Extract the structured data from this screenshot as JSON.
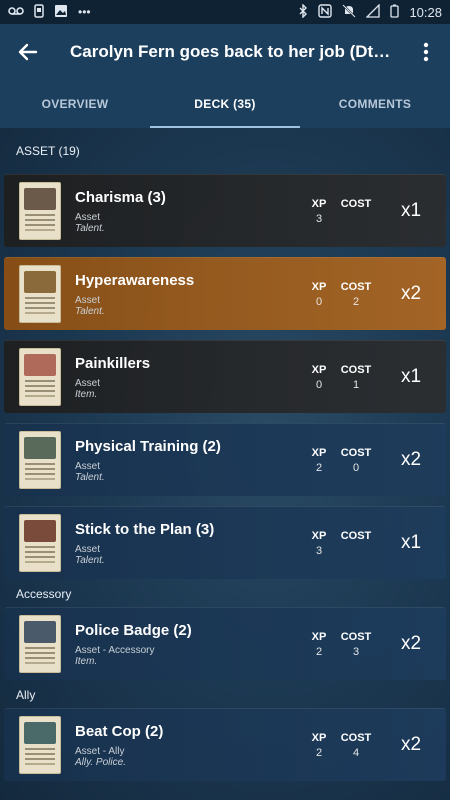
{
  "statusbar": {
    "time": "10:28"
  },
  "header": {
    "title": "Carolyn Fern goes back to her job (DttF ..."
  },
  "tabs": [
    {
      "label": "OVERVIEW"
    },
    {
      "label": "DECK (35)"
    },
    {
      "label": "COMMENTS"
    }
  ],
  "deck": {
    "section": "ASSET (19)",
    "sub_accessory": "Accessory",
    "sub_ally": "Ally",
    "cards": [
      {
        "name": "Charisma (3)",
        "type": "Asset",
        "traits": "Talent.",
        "xp_label": "XP",
        "xp": "3",
        "cost_label": "COST",
        "cost": "",
        "qty": "x1",
        "faction": "neutral",
        "art_color": "#6b5a4a"
      },
      {
        "name": "Hyperawareness",
        "type": "Asset",
        "traits": "Talent.",
        "xp_label": "XP",
        "xp": "0",
        "cost_label": "COST",
        "cost": "2",
        "qty": "x2",
        "faction": "seeker",
        "art_color": "#8a6a3a"
      },
      {
        "name": "Painkillers",
        "type": "Asset",
        "traits": "Item.",
        "xp_label": "XP",
        "xp": "0",
        "cost_label": "COST",
        "cost": "1",
        "qty": "x1",
        "faction": "neutral",
        "art_color": "#b06a5a"
      },
      {
        "name": "Physical Training (2)",
        "type": "Asset",
        "traits": "Talent.",
        "xp_label": "XP",
        "xp": "2",
        "cost_label": "COST",
        "cost": "0",
        "qty": "x2",
        "faction": "guardian",
        "art_color": "#5a6a5a"
      },
      {
        "name": "Stick to the Plan (3)",
        "type": "Asset",
        "traits": "Talent.",
        "xp_label": "XP",
        "xp": "3",
        "cost_label": "COST",
        "cost": "",
        "qty": "x1",
        "faction": "guardian",
        "art_color": "#7a4a3a"
      },
      {
        "name": "Police Badge (2)",
        "type": "Asset - Accessory",
        "traits": "Item.",
        "xp_label": "XP",
        "xp": "2",
        "cost_label": "COST",
        "cost": "3",
        "qty": "x2",
        "faction": "guardian",
        "art_color": "#4a5a6a"
      },
      {
        "name": "Beat Cop (2)",
        "type": "Asset - Ally",
        "traits": "Ally. Police.",
        "xp_label": "XP",
        "xp": "2",
        "cost_label": "COST",
        "cost": "4",
        "qty": "x2",
        "faction": "guardian",
        "art_color": "#4a6a6a"
      }
    ]
  },
  "colors": {
    "seeker": "#a8641f",
    "guardian": "#1e3c5c",
    "neutral": "#2b2b2b",
    "accent": "#9fc3df"
  }
}
